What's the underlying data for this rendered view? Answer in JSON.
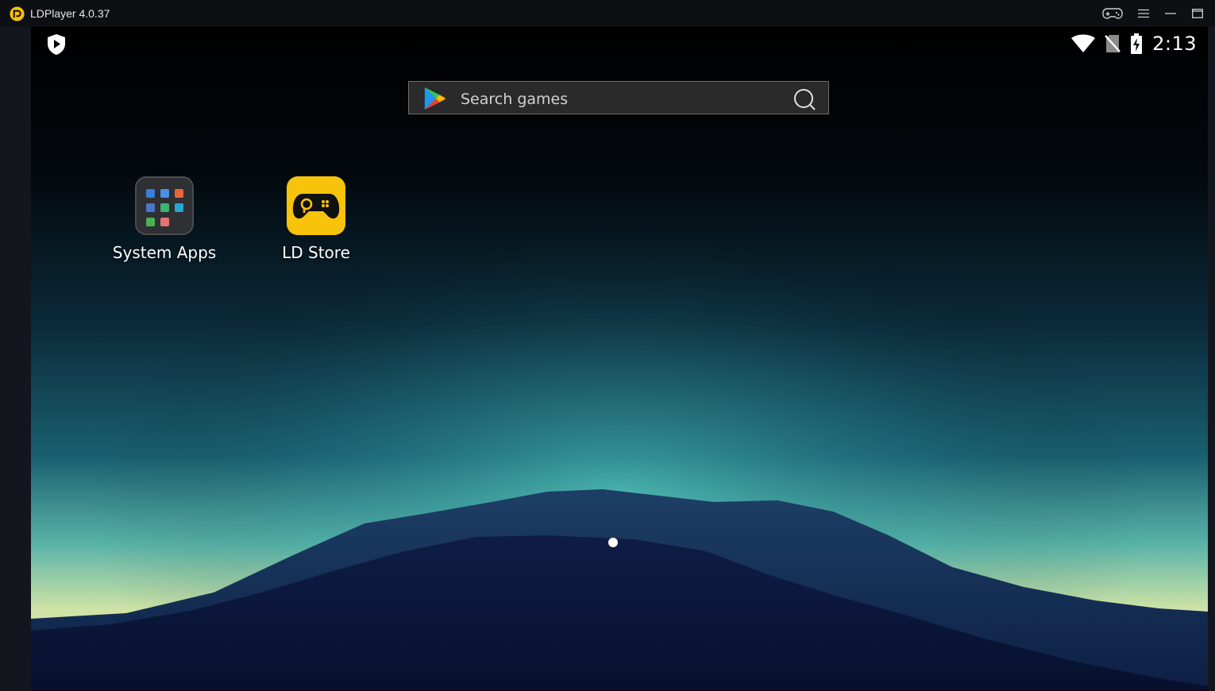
{
  "window": {
    "title": "LDPlayer 4.0.37",
    "controls": [
      "gamepad-icon",
      "menu-icon",
      "minimize-icon",
      "maximize-icon"
    ]
  },
  "status_bar": {
    "time": "2:13",
    "icons": [
      "shield-icon",
      "wifi-icon",
      "no-sim-icon",
      "battery-charging-icon"
    ]
  },
  "search": {
    "placeholder": "Search games"
  },
  "apps": [
    {
      "label": "System Apps",
      "icon": "folder-icon"
    },
    {
      "label": "LD Store",
      "icon": "gamepad-icon"
    }
  ],
  "pager": {
    "current_page": 1,
    "total_pages": 1
  },
  "colors": {
    "ld_yellow": "#f7c30b",
    "titlebar": "#0d0f13",
    "search_bg": "#2a2a2a"
  }
}
